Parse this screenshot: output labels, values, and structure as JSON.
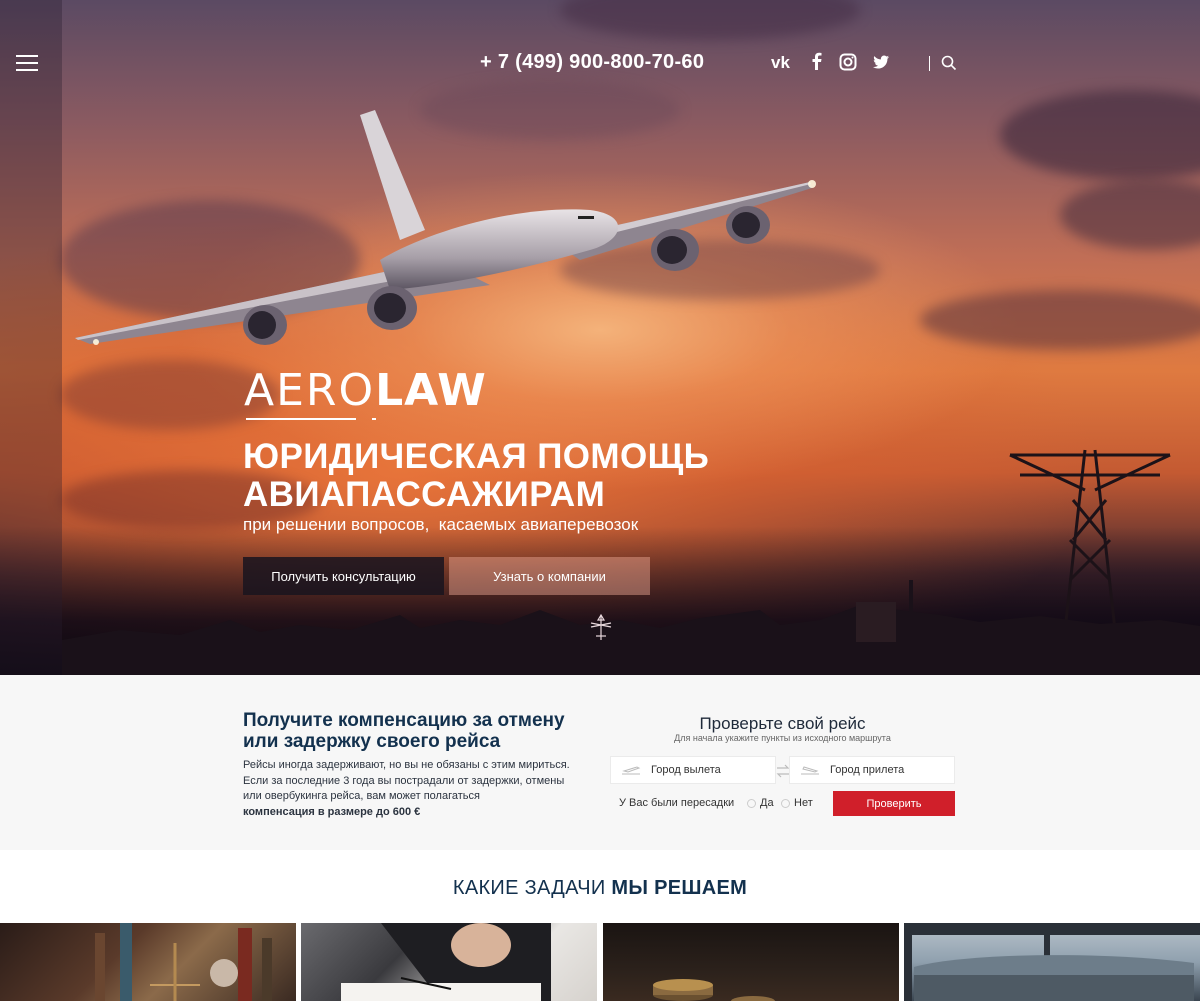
{
  "header": {
    "phone": "+ 7 (499) 900-800-70-60",
    "social_vk": "vk",
    "social_icons": [
      "vk-icon",
      "facebook-icon",
      "instagram-icon",
      "twitter-icon"
    ]
  },
  "hero": {
    "logo_light": "AERO",
    "logo_bold": "LAW",
    "title_line1": "ЮРИДИЧЕСКАЯ ПОМОЩЬ",
    "title_line2": "АВИАПАССАЖИРАМ",
    "subtitle": "при решении вопросов,  касаемых авиаперевозок",
    "btn_consult": "Получить консультацию",
    "btn_about": "Узнать о компании"
  },
  "compensation": {
    "title": "Получите компенсацию за отмену или задержку своего рейса",
    "text_line1": "Рейсы иногда задерживают, но вы не обязаны с этим мириться.",
    "text_line2": "Если за последние 3 года вы пострадали от задержки, отмены",
    "text_line3": "или овербукинга рейса, вам может полагаться",
    "text_bold": "компенсация в размере до 600 €"
  },
  "verify": {
    "title": "Проверьте свой рейс",
    "hint": "Для начала укажите пункты из исходного маршрута",
    "departure_placeholder": "Город вылета",
    "arrival_placeholder": "Город прилета",
    "transfer_label": "У Вас были пересадки",
    "option_yes": "Да",
    "option_no": "Нет",
    "submit": "Проверить"
  },
  "tasks": {
    "title_light": "КАКИЕ ЗАДАЧИ",
    "title_bold": "МЫ РЕШАЕМ"
  },
  "colors": {
    "accent_red": "#d01f2a",
    "navy": "#13314e"
  }
}
